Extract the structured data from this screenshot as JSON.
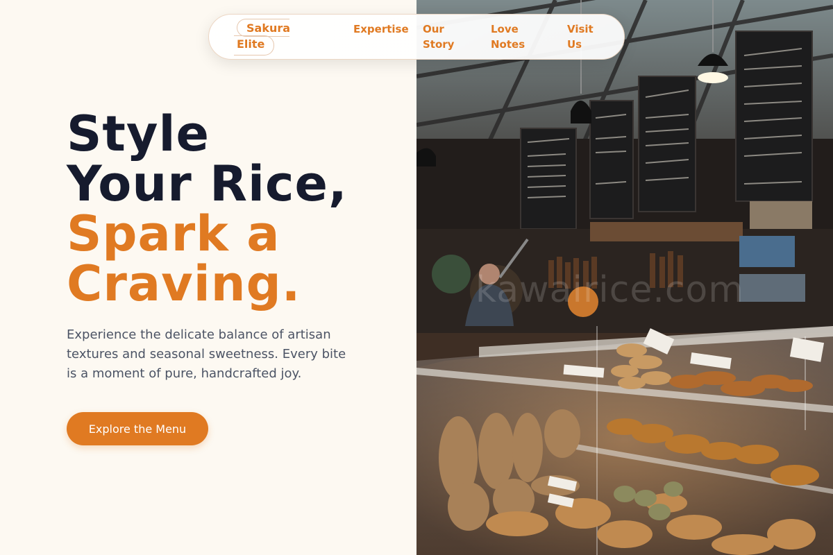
{
  "brand": {
    "line1": "Sakura",
    "line2": "Elite"
  },
  "nav": {
    "expertise": "Expertise",
    "story": "Our Story",
    "love_notes": "Love Notes",
    "visit": "Visit Us"
  },
  "hero": {
    "line1": "Style",
    "line2": "Your Rice,",
    "line3": "Spark a",
    "line4": "Craving.",
    "subtext": "Experience the delicate balance of artisan textures and seasonal sweetness. Every bite is a moment of pure, handcrafted joy.",
    "cta": "Explore the Menu"
  },
  "photo": {
    "watermark": "kawairice.com"
  },
  "colors": {
    "accent": "#e07a22",
    "heading": "#161b2e",
    "background": "#fdf9f2"
  }
}
